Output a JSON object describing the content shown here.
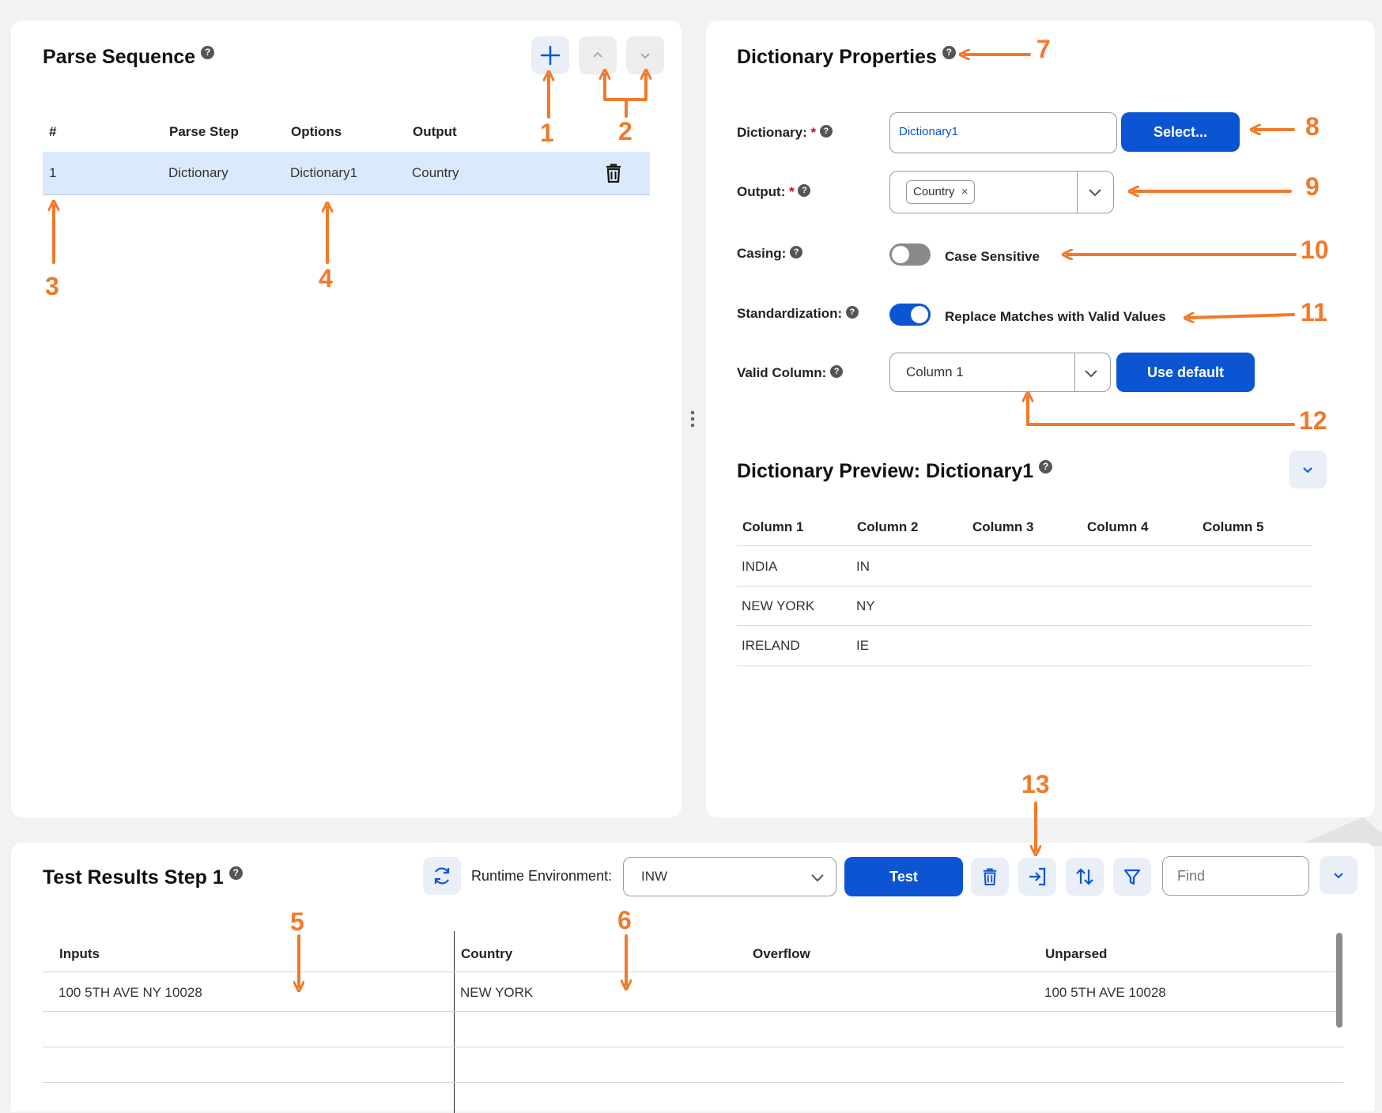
{
  "parse_sequence": {
    "title": "Parse Sequence",
    "help": "?",
    "columns": [
      "#",
      "Parse Step",
      "Options",
      "Output"
    ],
    "rows": [
      {
        "num": "1",
        "step": "Dictionary",
        "options": "Dictionary1",
        "output": "Country"
      }
    ],
    "icons": {
      "add": "plus-icon",
      "up": "chevron-up-icon",
      "down": "chevron-down-icon",
      "delete": "trash-icon"
    }
  },
  "dictionary_properties": {
    "title": "Dictionary Properties",
    "help": "?",
    "dictionary": {
      "label": "Dictionary:",
      "required": "*",
      "value": "Dictionary1",
      "select_label": "Select..."
    },
    "output": {
      "label": "Output:",
      "required": "*",
      "chip": "Country",
      "chip_remove": "×"
    },
    "casing": {
      "label": "Casing:",
      "toggle_label": "Case Sensitive",
      "enabled": false
    },
    "standardization": {
      "label": "Standardization:",
      "toggle_label": "Replace Matches with Valid Values",
      "enabled": true
    },
    "valid_column": {
      "label": "Valid Column:",
      "value": "Column 1",
      "use_default_label": "Use default"
    }
  },
  "dictionary_preview": {
    "title": "Dictionary Preview: Dictionary1",
    "help": "?",
    "columns": [
      "Column 1",
      "Column 2",
      "Column 3",
      "Column 4",
      "Column 5"
    ],
    "rows": [
      [
        "INDIA",
        "IN"
      ],
      [
        "NEW YORK",
        "NY"
      ],
      [
        "IRELAND",
        "IE"
      ]
    ]
  },
  "test_results": {
    "title": "Test Results Step 1",
    "help": "?",
    "runtime_label": "Runtime Environment:",
    "runtime_value": "INW",
    "test_label": "Test",
    "find_placeholder": "Find",
    "columns": [
      "Inputs",
      "Country",
      "Overflow",
      "Unparsed"
    ],
    "rows": [
      {
        "inputs": "100 5TH AVE NY 10028",
        "country": "NEW YORK",
        "overflow": "",
        "unparsed": "100 5TH AVE 10028"
      }
    ],
    "icons": [
      "refresh-icon",
      "trash-icon",
      "import-icon",
      "sort-icon",
      "filter-icon",
      "chevron-down-icon"
    ]
  },
  "annotations": [
    "1",
    "2",
    "3",
    "4",
    "5",
    "6",
    "7",
    "8",
    "9",
    "10",
    "11",
    "12",
    "13"
  ],
  "colors": {
    "accent": "#0b55d3",
    "annotation": "#f07a2a",
    "selected_row": "#dae9fb",
    "background": "#f2f2f2"
  }
}
